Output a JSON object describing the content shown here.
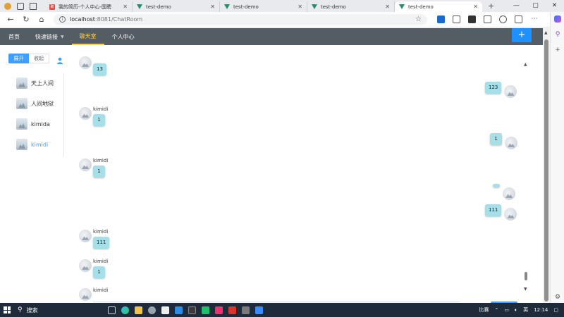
{
  "browser": {
    "tabs": [
      {
        "title": "我的简历-个人中心-国聘",
        "favicon": "guopin-icon"
      },
      {
        "title": "test-demo",
        "favicon": "vue-icon"
      },
      {
        "title": "test-demo",
        "favicon": "vue-icon"
      },
      {
        "title": "test-demo",
        "favicon": "vue-icon"
      },
      {
        "title": "test-demo",
        "favicon": "vue-icon"
      }
    ],
    "active_tab": 4,
    "url_host": "localhost",
    "url_path": ":8081/ChatRoom",
    "colors": {
      "tabstrip": "#e8eaed",
      "vue": "#2c8d6a"
    }
  },
  "app": {
    "menu": [
      {
        "label": "首页"
      },
      {
        "label": "快速链接"
      },
      {
        "label": "聊天室"
      },
      {
        "label": "个人中心"
      }
    ],
    "active_menu": 2,
    "add_button": "+",
    "colors": {
      "header": "#545c64",
      "active": "#ffd04b",
      "primary": "#1e90ff"
    }
  },
  "sidebar": {
    "expand_label": "展开",
    "collapse_label": "收起",
    "users": [
      {
        "name": "天上人间"
      },
      {
        "name": "人间地狱"
      },
      {
        "name": "kimida"
      },
      {
        "name": "kimidi"
      }
    ],
    "selected_user": 3
  },
  "chat": {
    "messages": [
      {
        "side": "left",
        "sender": "",
        "text": "13"
      },
      {
        "side": "right",
        "sender": "",
        "text": "123"
      },
      {
        "side": "left",
        "sender": "kimidi",
        "text": "1"
      },
      {
        "side": "right",
        "sender": "",
        "text": "1"
      },
      {
        "side": "left",
        "sender": "kimidi",
        "text": "1"
      },
      {
        "side": "right",
        "sender": "",
        "text": ""
      },
      {
        "side": "right",
        "sender": "",
        "text": "111"
      },
      {
        "side": "left",
        "sender": "kimidi",
        "text": "111"
      },
      {
        "side": "left",
        "sender": "kimidi",
        "text": "1"
      },
      {
        "side": "left",
        "sender": "kimidi",
        "text": ""
      }
    ],
    "bubble_color": "#a6dfe8"
  },
  "taskbar": {
    "search_label": "搜索",
    "tray_text": "比赛",
    "ime": "英",
    "time": "12:14"
  }
}
